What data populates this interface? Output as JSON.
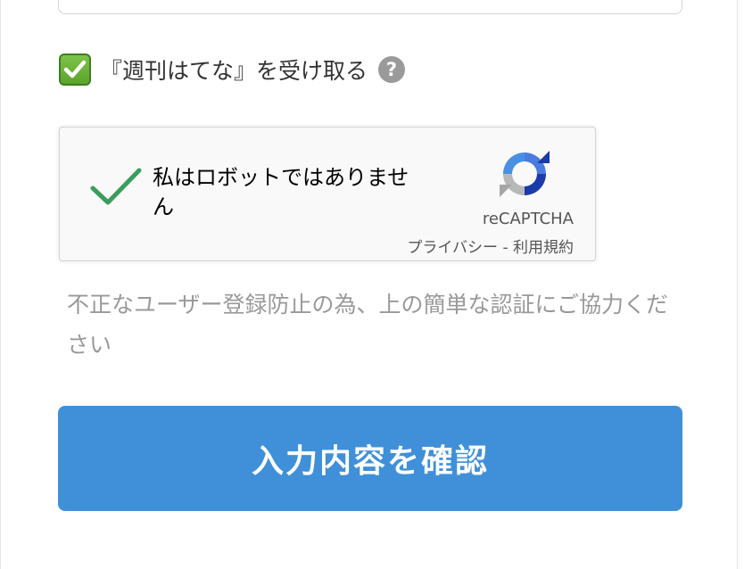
{
  "newsletter": {
    "checked": true,
    "label": "『週刊はてな』を受け取る",
    "help_icon": "question-mark-icon",
    "help_glyph": "?"
  },
  "recaptcha": {
    "verified": true,
    "label": "私はロボットではありません",
    "brand": "reCAPTCHA",
    "privacy_link": "プライバシー",
    "separator": " - ",
    "terms_link": "利用規約"
  },
  "notice": "不正なユーザー登録防止の為、上の簡単な認証にご協力ください",
  "confirm_button": "入力内容を確認",
  "colors": {
    "primary_button": "#3f90d8",
    "checkbox_green": "#5aa52b",
    "recaptcha_check": "#3a9d5d",
    "notice_text": "#999999"
  }
}
